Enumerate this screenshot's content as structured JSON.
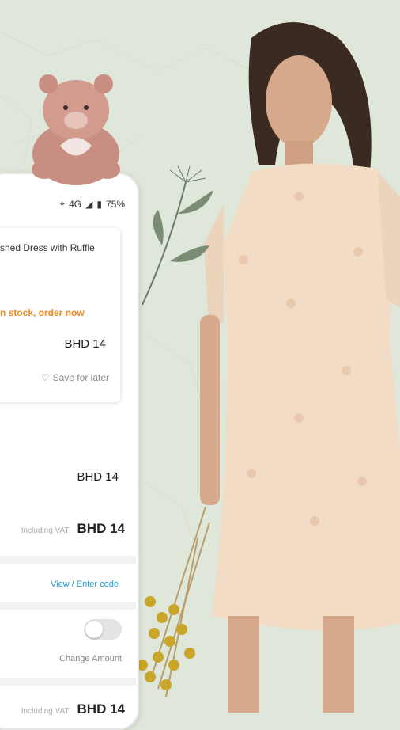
{
  "status_bar": {
    "network": "4G",
    "battery": "75%"
  },
  "cart_item": {
    "name": "shed Dress with Ruffle",
    "stock_message": "n stock, order now",
    "price": "BHD 14",
    "save_for_later": "Save for later"
  },
  "summary": {
    "subtotal": "BHD 14",
    "vat_label": "Including VAT",
    "total": "BHD 14"
  },
  "voucher": {
    "link": "View / Enter code"
  },
  "wallet": {
    "change_amount": "Change Amount"
  },
  "footer": {
    "vat_label": "Including VAT",
    "total": "BHD 14"
  },
  "colors": {
    "accent_orange": "#f08a2a",
    "link_blue": "#1e9ad6",
    "background": "#dfe6da"
  }
}
